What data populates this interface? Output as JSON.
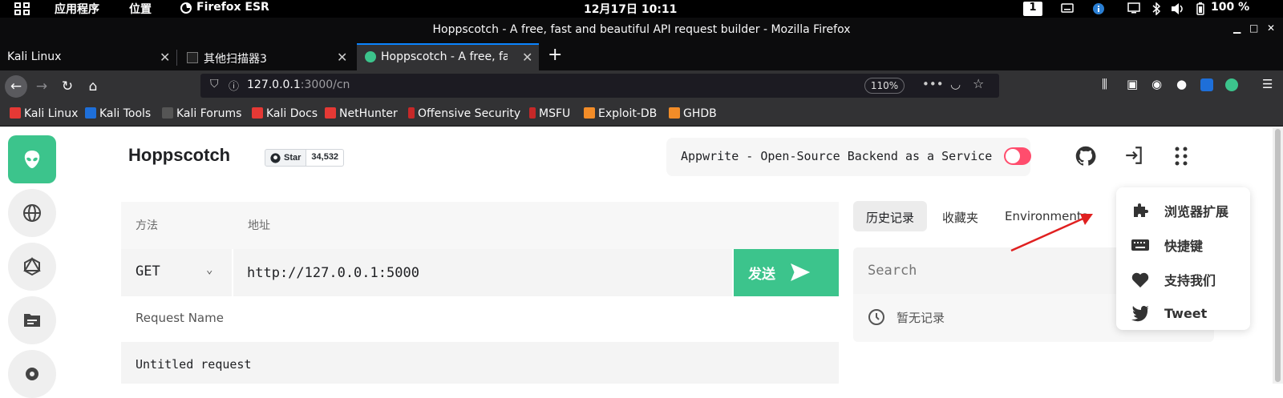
{
  "topbar": {
    "apps": "应用程序",
    "places": "位置",
    "firefox": "Firefox ESR",
    "clock": "12月17日 10:11",
    "workspace": "1",
    "battery": "100 %"
  },
  "window": {
    "title": "Hoppscotch - A free, fast and beautiful API request builder - Mozilla Firefox"
  },
  "tabs": [
    {
      "label": "Kali Linux"
    },
    {
      "label": "其他扫描器3"
    },
    {
      "label": "Hoppscotch - A free, fast"
    }
  ],
  "nav": {
    "url_host": "127.0.0.1",
    "url_rest": ":3000/cn",
    "zoom": "110%"
  },
  "bookmarks": [
    {
      "label": "Kali Linux",
      "color": "#e53935"
    },
    {
      "label": "Kali Tools",
      "color": "#1e6fd9"
    },
    {
      "label": "Kali Forums",
      "color": "#333333"
    },
    {
      "label": "Kali Docs",
      "color": "#e53935"
    },
    {
      "label": "NetHunter",
      "color": "#e53935"
    },
    {
      "label": "Offensive Security",
      "color": "#c62828"
    },
    {
      "label": "MSFU",
      "color": "#c62828"
    },
    {
      "label": "Exploit-DB",
      "color": "#f28c28"
    },
    {
      "label": "GHDB",
      "color": "#f28c28"
    }
  ],
  "app": {
    "brand": "Hoppscotch",
    "star_label": "Star",
    "star_count": "34,532",
    "promo": "Appwrite - Open-Source Backend as a Service",
    "accent": "#3cc48c"
  },
  "request": {
    "method_label": "方法",
    "url_label": "地址",
    "method": "GET",
    "url": "http://127.0.0.1:5000",
    "send": "发送",
    "name_label": "Request Name",
    "name_value": "Untitled request"
  },
  "right_tabs": {
    "history": "历史记录",
    "collections": "收藏夹",
    "environments": "Environments"
  },
  "history": {
    "search_placeholder": "Search",
    "empty": "暂无记录"
  },
  "menu": [
    {
      "label": "浏览器扩展",
      "icon": "puzzle-icon"
    },
    {
      "label": "快捷键",
      "icon": "keyboard-icon"
    },
    {
      "label": "支持我们",
      "icon": "heart-icon"
    },
    {
      "label": "Tweet",
      "icon": "twitter-icon"
    }
  ]
}
